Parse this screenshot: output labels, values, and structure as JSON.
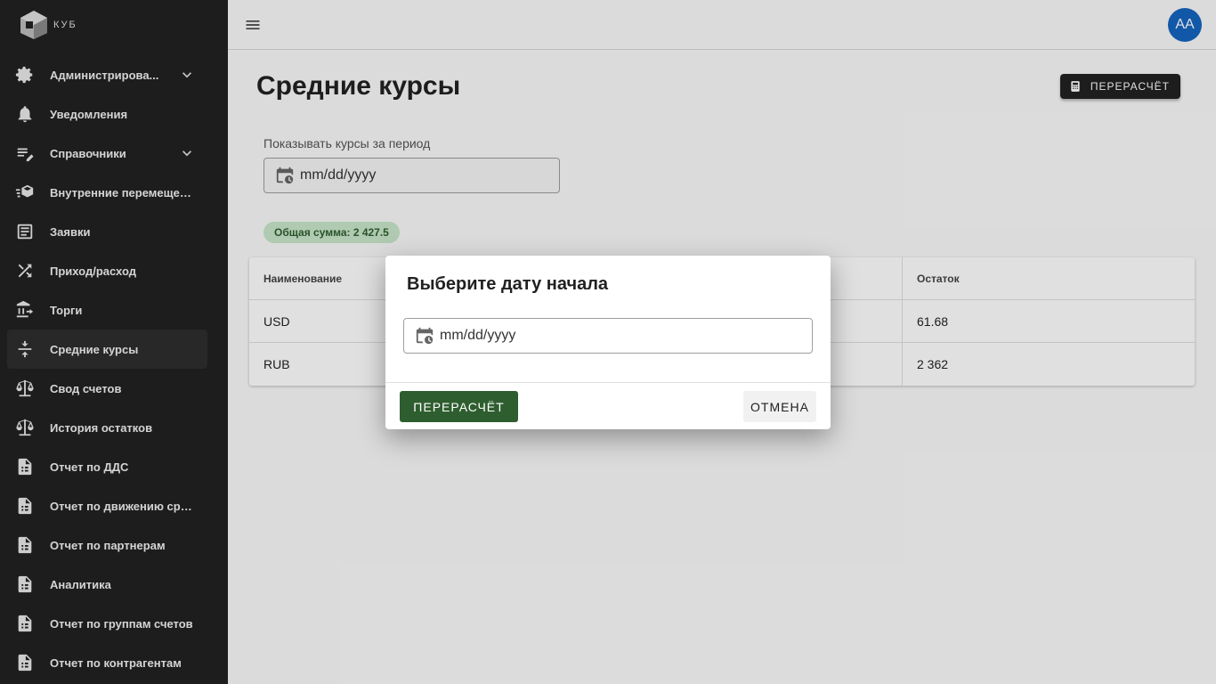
{
  "brand": {
    "name": "КУБ"
  },
  "sidebar": {
    "items": [
      {
        "label": "Администрирова...",
        "icon": "gear-icon",
        "expandable": true
      },
      {
        "label": "Уведомления",
        "icon": "bell-icon",
        "expandable": false
      },
      {
        "label": "Справочники",
        "icon": "edit-list-icon",
        "expandable": true
      },
      {
        "label": "Внутренние перемещения",
        "icon": "cube-move-icon",
        "expandable": false
      },
      {
        "label": "Заявки",
        "icon": "document-icon",
        "expandable": false
      },
      {
        "label": "Приход/расход",
        "icon": "shuffle-icon",
        "expandable": false
      },
      {
        "label": "Торги",
        "icon": "bank-icon",
        "expandable": false
      },
      {
        "label": "Средние курсы",
        "icon": "compress-icon",
        "expandable": false,
        "active": true
      },
      {
        "label": "Свод счетов",
        "icon": "scale-icon",
        "expandable": false
      },
      {
        "label": "История остатков",
        "icon": "scale-icon",
        "expandable": false
      },
      {
        "label": "Отчет по ДДС",
        "icon": "report-icon",
        "expandable": false
      },
      {
        "label": "Отчет по движению сред...",
        "icon": "report-icon",
        "expandable": false
      },
      {
        "label": "Отчет по партнерам",
        "icon": "report-icon",
        "expandable": false
      },
      {
        "label": "Аналитика",
        "icon": "report-icon",
        "expandable": false
      },
      {
        "label": "Отчет по группам счетов",
        "icon": "report-icon",
        "expandable": false
      },
      {
        "label": "Отчет по контрагентам",
        "icon": "report-icon",
        "expandable": false
      }
    ]
  },
  "topbar": {
    "avatar_initials": "AA"
  },
  "page": {
    "title": "Средние курсы",
    "recalc_button": "ПЕРЕРАСЧЁТ",
    "period_label": "Показывать курсы за период",
    "period_placeholder": "mm/dd/yyyy",
    "total_chip": "Общая сумма: 2 427.5"
  },
  "table": {
    "headers": [
      "Наименование",
      "Остаток"
    ],
    "rows": [
      [
        "USD",
        "61.68"
      ],
      [
        "RUB",
        "2 362"
      ]
    ]
  },
  "dialog": {
    "title": "Выберите дату начала",
    "date_placeholder": "mm/dd/yyyy",
    "confirm_label": "ПЕРЕРАСЧЁТ",
    "cancel_label": "ОТМЕНА"
  },
  "colors": {
    "sidebar_bg": "#212121",
    "accent_green": "#2e5e2f",
    "chip_bg": "#c8e6c9",
    "avatar_bg": "#1565c0"
  }
}
